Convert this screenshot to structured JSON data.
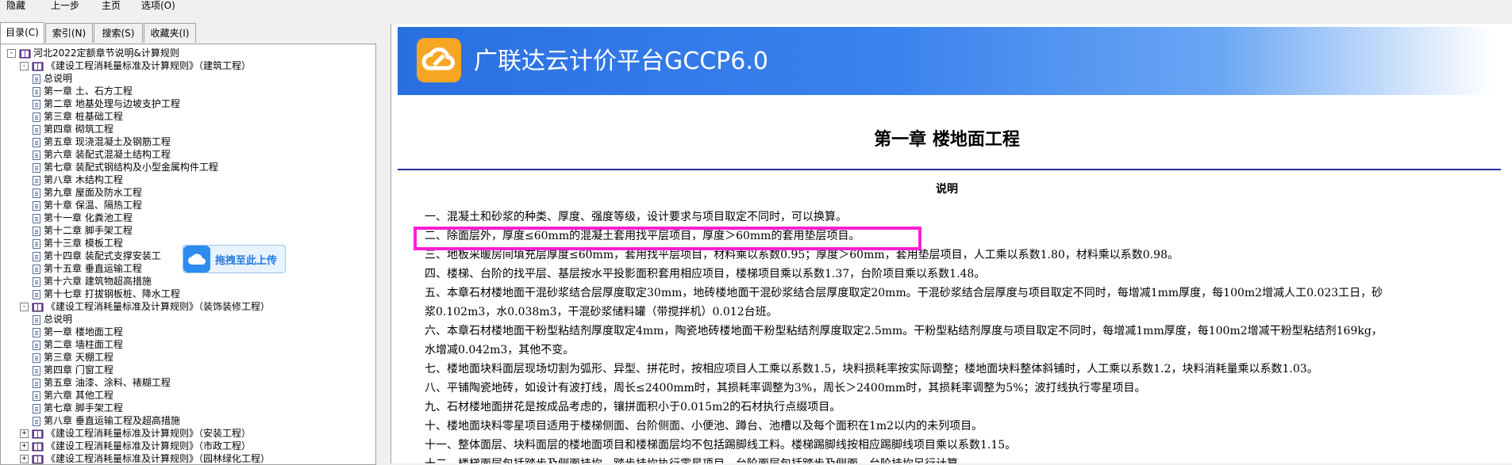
{
  "menu": [
    "隐藏",
    "上一步",
    "主页",
    "选项(O)"
  ],
  "tabs": [
    "目录(C)",
    "索引(N)",
    "搜索(S)",
    "收藏夹(I)"
  ],
  "tree": [
    {
      "level": 0,
      "exp": "-",
      "icon": "book",
      "label": "河北2022定额章节说明&计算规则"
    },
    {
      "level": 1,
      "exp": "-",
      "icon": "book",
      "label": "《建设工程消耗量标准及计算规则》（建筑工程）"
    },
    {
      "level": 2,
      "icon": "page",
      "label": "总说明"
    },
    {
      "level": 2,
      "icon": "page",
      "label": "第一章 土、石方工程"
    },
    {
      "level": 2,
      "icon": "page",
      "label": "第二章 地基处理与边坡支护工程"
    },
    {
      "level": 2,
      "icon": "page",
      "label": "第三章 桩基础工程"
    },
    {
      "level": 2,
      "icon": "page",
      "label": "第四章 砌筑工程"
    },
    {
      "level": 2,
      "icon": "page",
      "label": "第五章 现浇混凝土及钢筋工程"
    },
    {
      "level": 2,
      "icon": "page",
      "label": "第六章 装配式混凝土结构工程"
    },
    {
      "level": 2,
      "icon": "page",
      "label": "第七章 装配式钢结构及小型金属构件工程"
    },
    {
      "level": 2,
      "icon": "page",
      "label": "第八章 木结构工程"
    },
    {
      "level": 2,
      "icon": "page",
      "label": "第九章 屋面及防水工程"
    },
    {
      "level": 2,
      "icon": "page",
      "label": "第十章 保温、隔热工程"
    },
    {
      "level": 2,
      "icon": "page",
      "label": "第十一章 化粪池工程"
    },
    {
      "level": 2,
      "icon": "page",
      "label": "第十二章 脚手架工程"
    },
    {
      "level": 2,
      "icon": "page",
      "label": "第十三章 模板工程"
    },
    {
      "level": 2,
      "icon": "page",
      "label": "第十四章 装配式支撑安装工"
    },
    {
      "level": 2,
      "icon": "page",
      "label": "第十五章 垂直运输工程"
    },
    {
      "level": 2,
      "icon": "page",
      "label": "第十六章 建筑物超高措施"
    },
    {
      "level": 2,
      "icon": "page",
      "label": "第十七章 打拔钢板桩、降水工程"
    },
    {
      "level": 1,
      "exp": "-",
      "icon": "book",
      "label": "《建设工程消耗量标准及计算规则》（装饰装修工程）"
    },
    {
      "level": 2,
      "icon": "page",
      "label": "总说明"
    },
    {
      "level": 2,
      "icon": "page",
      "label": "第一章 楼地面工程"
    },
    {
      "level": 2,
      "icon": "page",
      "label": "第二章 墙柱面工程"
    },
    {
      "level": 2,
      "icon": "page",
      "label": "第三章 天棚工程"
    },
    {
      "level": 2,
      "icon": "page",
      "label": "第四章 门窗工程"
    },
    {
      "level": 2,
      "icon": "page",
      "label": "第五章 油漆、涂料、裱糊工程"
    },
    {
      "level": 2,
      "icon": "page",
      "label": "第六章 其他工程"
    },
    {
      "level": 2,
      "icon": "page",
      "label": "第七章 脚手架工程"
    },
    {
      "level": 2,
      "icon": "page",
      "label": "第八章 垂直运输工程及超高措施"
    },
    {
      "level": 1,
      "exp": "+",
      "icon": "book",
      "label": "《建设工程消耗量标准及计算规则》（安装工程）"
    },
    {
      "level": 1,
      "exp": "+",
      "icon": "book",
      "label": "《建设工程消耗量标准及计算规则》（市政工程）"
    },
    {
      "level": 1,
      "exp": "+",
      "icon": "book",
      "label": "《建设工程消耗量标准及计算规则》（园林绿化工程）"
    }
  ],
  "upload_badge": {
    "label": "拖拽至此上传"
  },
  "banner": {
    "title": "广联达云计价平台GCCP6.0"
  },
  "chapter_title": "第一章  楼地面工程",
  "section_title": "说明",
  "lines": [
    "一、混凝土和砂浆的种类、厚度、强度等级，设计要求与项目取定不同时，可以换算。",
    "二、除面层外，厚度≤60mm的混凝土套用找平层项目，厚度＞60mm的套用垫层项目。",
    "三、地板采暖房间填充层厚度≤60mm，套用找平层项目，材料乘以系数0.95；厚度＞60mm，套用垫层项目，人工乘以系数1.80，材料乘以系数0.98。",
    "四、楼梯、台阶的找平层、基层按水平投影面积套用相应项目，楼梯项目乘以系数1.37，台阶项目乘以系数1.48。",
    "五、本章石材楼地面干混砂浆结合层厚度取定30mm，地砖楼地面干混砂浆结合层厚度取定20mm。干混砂浆结合层厚度与项目取定不同时，每增减1mm厚度，每100m2增减人工0.023工日，砂",
    "浆0.102m3，水0.038m3，干混砂浆储料罐（带搅拌机）0.012台班。",
    "六、本章石材楼地面干粉型粘结剂厚度取定4mm，陶瓷地砖楼地面干粉型粘结剂厚度取定2.5mm。干粉型粘结剂厚度与项目取定不同时，每增减1mm厚度，每100m2增减干粉型粘结剂169kg，",
    "水增减0.042m3，其他不变。",
    "七、楼地面块料面层现场切割为弧形、异型、拼花时，按相应项目人工乘以系数1.5，块料损耗率按实际调整；楼地面块料整体斜铺时，人工乘以系数1.2，块料消耗量乘以系数1.03。",
    "八、平铺陶瓷地砖，如设计有波打线，周长≤2400mm时，其损耗率调整为3%，周长＞2400mm时，其损耗率调整为5%；波打线执行零星项目。",
    "九、石材楼地面拼花是按成品考虑的，镶拼面积小于0.015m2的石材执行点缀项目。",
    "十、楼地面块料零星项目适用于楼梯侧面、台阶侧面、小便池、蹲台、池槽以及每个面积在1m2以内的未列项目。",
    "十一、整体面层、块料面层的楼地面项目和楼梯面层均不包括踢脚线工料。楼梯踢脚线按相应踢脚线项目乘以系数1.15。",
    "十二、楼梯面层包括踏步及侧面挂坎，踏步挂坎执行零星项目。台阶面层包括踏步及侧面，台阶挂坎另行计算。"
  ]
}
